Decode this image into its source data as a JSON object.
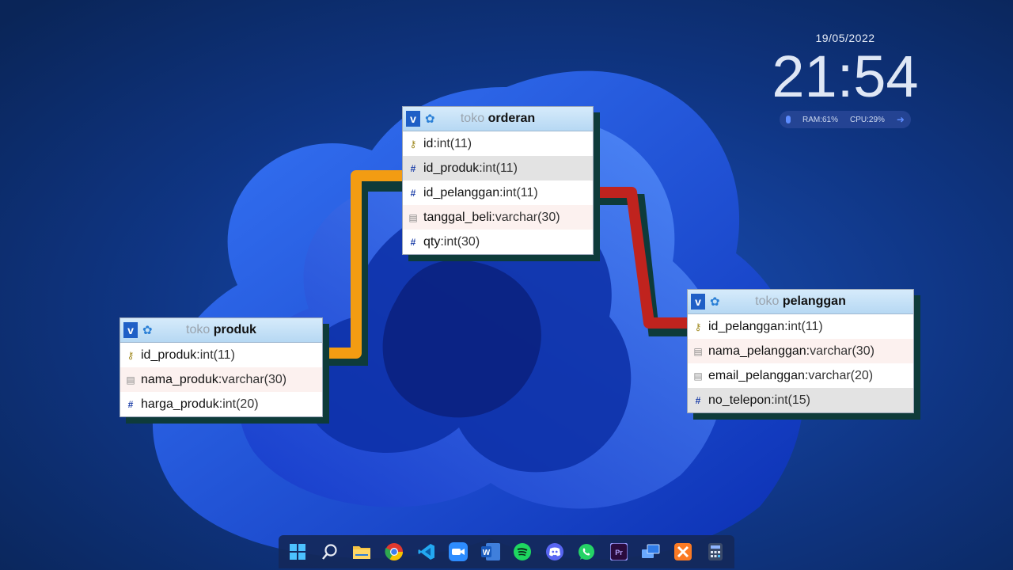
{
  "widget": {
    "date": "19/05/2022",
    "time": "21:54",
    "ram": "RAM:61%",
    "cpu": "CPU:29%"
  },
  "tables": {
    "orderan": {
      "db": "toko",
      "name": "orderan",
      "columns": [
        {
          "name": "id",
          "type": "int(11)",
          "icon": "key-icon"
        },
        {
          "name": "id_produk",
          "type": "int(11)",
          "icon": "hash-icon"
        },
        {
          "name": "id_pelanggan",
          "type": "int(11)",
          "icon": "hash-icon"
        },
        {
          "name": "tanggal_beli",
          "type": "varchar(30)",
          "icon": "text-icon"
        },
        {
          "name": "qty",
          "type": "int(30)",
          "icon": "hash-icon"
        }
      ]
    },
    "produk": {
      "db": "toko",
      "name": "produk",
      "columns": [
        {
          "name": "id_produk",
          "type": "int(11)",
          "icon": "key-icon"
        },
        {
          "name": "nama_produk",
          "type": "varchar(30)",
          "icon": "text-icon"
        },
        {
          "name": "harga_produk",
          "type": "int(20)",
          "icon": "hash-icon"
        }
      ]
    },
    "pelanggan": {
      "db": "toko",
      "name": "pelanggan",
      "columns": [
        {
          "name": "id_pelanggan",
          "type": "int(11)",
          "icon": "key-icon"
        },
        {
          "name": "nama_pelanggan",
          "type": "varchar(30)",
          "icon": "text-icon"
        },
        {
          "name": "email_pelanggan",
          "type": "varchar(20)",
          "icon": "text-icon"
        },
        {
          "name": "no_telepon",
          "type": "int(15)",
          "icon": "hash-icon"
        }
      ]
    }
  },
  "sep": " : ",
  "colors": {
    "link_produk": "#f39c12",
    "link_pelanggan": "#c0231e",
    "header": "#b6d8f3"
  },
  "taskbar": [
    "windows-start-icon",
    "search-icon",
    "file-explorer-icon",
    "chrome-icon",
    "vscode-icon",
    "zoom-icon",
    "word-icon",
    "spotify-icon",
    "discord-icon",
    "whatsapp-icon",
    "premiere-icon",
    "remote-desktop-icon",
    "xampp-icon",
    "calculator-icon"
  ]
}
